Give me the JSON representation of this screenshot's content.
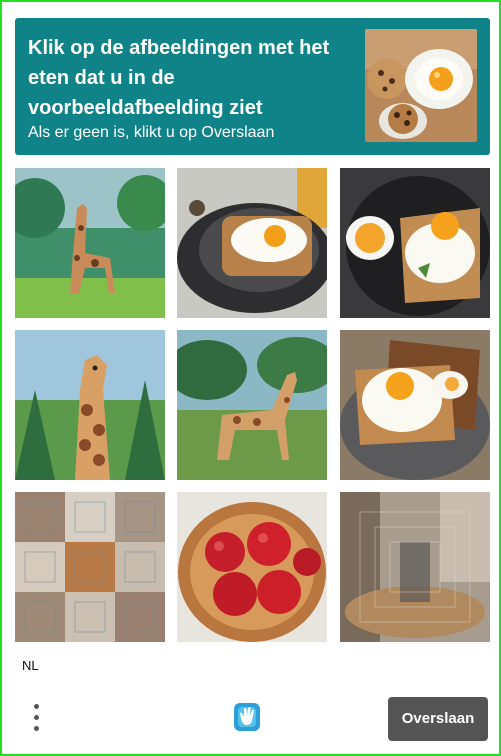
{
  "challenge": {
    "title": "Klik op de afbeeldingen met het eten dat u in de voorbeeldafbeelding ziet",
    "subtitle": "Als er geen is, klikt u op Overslaan",
    "example_image": "eggs-and-cookies-on-plates"
  },
  "grid": {
    "tiles": [
      {
        "content": "giraffe-painting-forest"
      },
      {
        "content": "fried-egg-on-toast-on-plate"
      },
      {
        "content": "fried-egg-on-toast-with-sauce"
      },
      {
        "content": "giraffe-painting-closeup"
      },
      {
        "content": "giraffe-painting-grassland"
      },
      {
        "content": "fried-eggs-on-toast-stack"
      },
      {
        "content": "distorted-noise-pattern"
      },
      {
        "content": "apples-in-basket"
      },
      {
        "content": "distorted-blurred-scene"
      }
    ]
  },
  "footer": {
    "language": "NL",
    "menu_icon": "more-vertical-icon",
    "logo_icon": "hcaptcha-hand-icon",
    "skip_label": "Overslaan"
  },
  "colors": {
    "header_bg": "#0f8388",
    "border": "#22e022",
    "skip_bg": "#555555"
  }
}
